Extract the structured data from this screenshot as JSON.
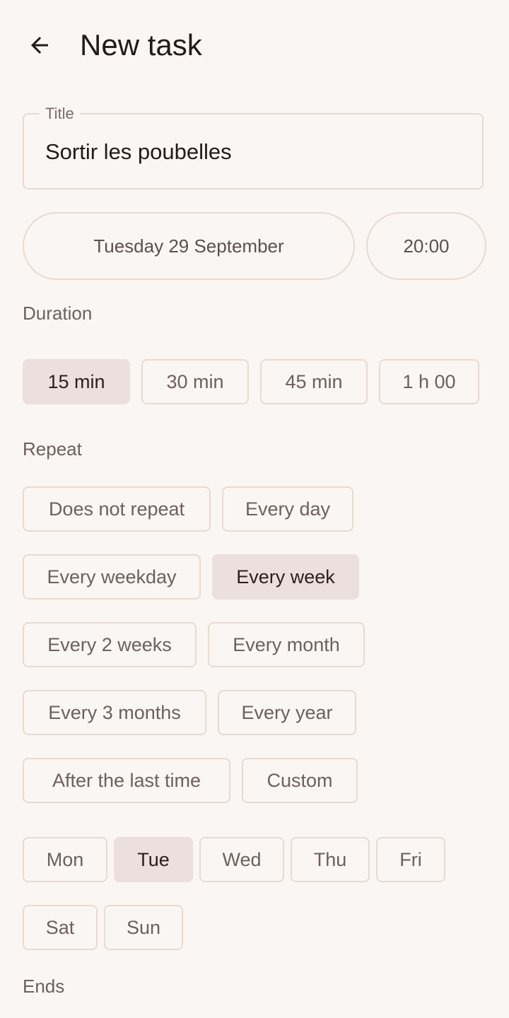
{
  "header": {
    "back_icon": "arrow-left-icon",
    "title": "New task"
  },
  "title_field": {
    "label": "Title",
    "value": "Sortir les poubelles"
  },
  "date_button": {
    "label": "Tuesday 29 September"
  },
  "time_button": {
    "label": "20:00"
  },
  "duration": {
    "label": "Duration",
    "options": [
      "15 min",
      "30 min",
      "45 min",
      "1 h 00"
    ],
    "selected": "15 min"
  },
  "repeat": {
    "label": "Repeat",
    "options": [
      "Does not repeat",
      "Every day",
      "Every weekday",
      "Every week",
      "Every 2 weeks",
      "Every month",
      "Every 3 months",
      "Every year",
      "After the last time",
      "Custom"
    ],
    "selected": "Every week"
  },
  "weekdays": {
    "options": [
      "Mon",
      "Tue",
      "Wed",
      "Thu",
      "Fri",
      "Sat",
      "Sun"
    ],
    "selected": "Tue"
  },
  "ends": {
    "label": "Ends"
  },
  "colors": {
    "background": "#faf6f3",
    "outline": "#e7dbd2",
    "selected_chip": "#ece0de",
    "text_primary": "#201a19",
    "text_secondary": "#6d605d"
  }
}
